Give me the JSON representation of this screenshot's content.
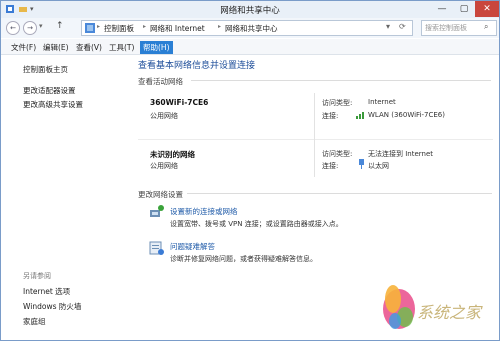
{
  "window": {
    "title": "网络和共享中心"
  },
  "window_buttons": {
    "minimize": "—",
    "maximize": "▢",
    "close": "✕"
  },
  "nav": {
    "back": "←",
    "forward": "→",
    "dropdown": "▾",
    "up": "↑"
  },
  "address": {
    "crumbs": [
      "控制面板",
      "网络和 Internet",
      "网络和共享中心"
    ],
    "sep": "▸",
    "search_placeholder": "搜索控制面板"
  },
  "menu": [
    "文件(F)",
    "编辑(E)",
    "查看(V)",
    "工具(T)",
    "帮助(H)"
  ],
  "sidebar": {
    "home": "控制面板主页",
    "items": [
      "更改适配器设置",
      "更改高级共享设置"
    ],
    "see_also_title": "另请参阅",
    "see_also": [
      "Internet 选项",
      "Windows 防火墙",
      "家庭组"
    ]
  },
  "main": {
    "heading": "查看基本网络信息并设置连接",
    "active_title": "查看活动网络",
    "networks": [
      {
        "name": "360WiFi-7CE6",
        "type": "公用网络",
        "access_label": "访问类型:",
        "access_value": "Internet",
        "conn_label": "连接:",
        "conn_value": "WLAN (360WiFi-7CE6)"
      },
      {
        "name": "未识别的网络",
        "type": "公用网络",
        "access_label": "访问类型:",
        "access_value": "无法连接到 Internet",
        "conn_label": "连接:",
        "conn_value": "以太网"
      }
    ],
    "change_title": "更改网络设置",
    "tasks": [
      {
        "title": "设置新的连接或网络",
        "desc": "设置宽带、拨号或 VPN 连接；或设置路由器或接入点。"
      },
      {
        "title": "问题疑难解答",
        "desc": "诊断并修复网络问题，或者获得疑难解答信息。"
      }
    ]
  },
  "watermark": {
    "text": "系统之家"
  }
}
